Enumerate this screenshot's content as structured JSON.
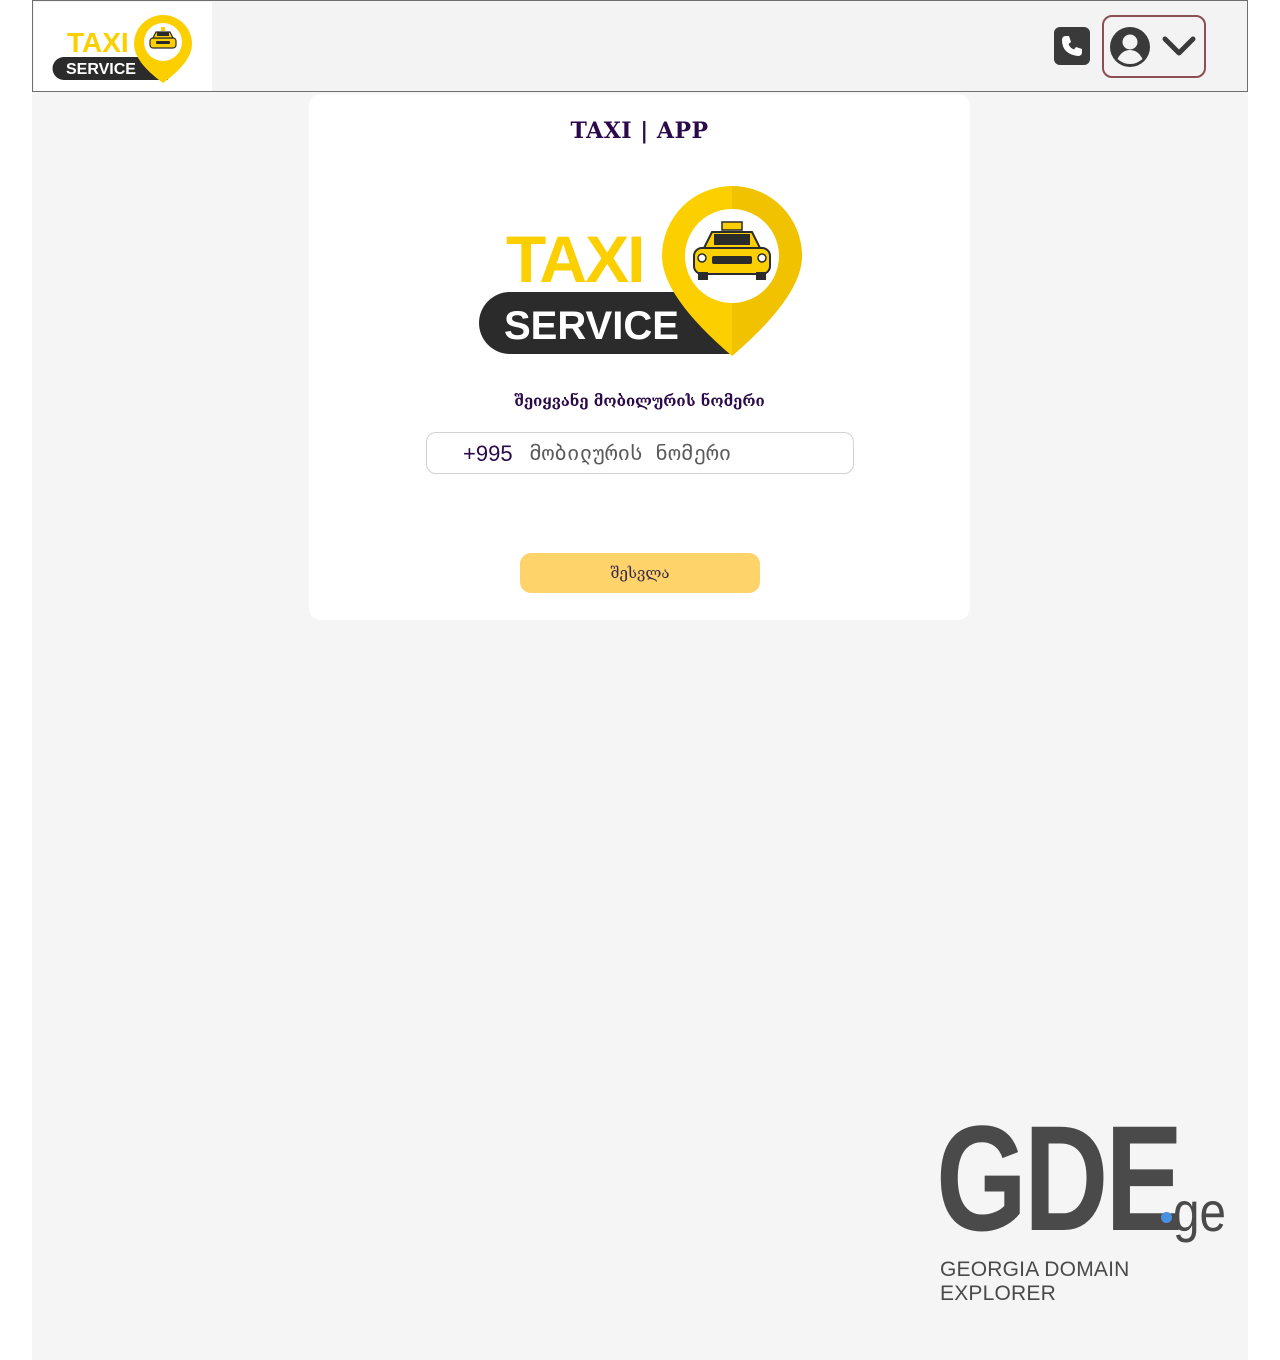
{
  "header": {
    "logo": {
      "text_top": "TAXI",
      "text_bottom": "SERVICE"
    },
    "phone_icon": "phone-icon",
    "user_icon": "user-circle-icon",
    "menu_icon": "chevron-down-icon"
  },
  "login": {
    "title": "TAXI | APP",
    "logo": {
      "text_top": "TAXI",
      "text_bottom": "SERVICE"
    },
    "phone_label": "შეიყვანე მობილურის ნომერი",
    "country_code": "+995",
    "phone_placeholder": "მობილურის ნომერი",
    "phone_value": "",
    "submit_label": "შესვლა"
  },
  "watermark": {
    "title": "GDE",
    "tld": "ge",
    "subtitle": "GEORGIA DOMAIN EXPLORER"
  },
  "colors": {
    "brand_yellow": "#fcd000",
    "button_yellow": "#fed36a",
    "dark_text": "#2a0a4a",
    "logo_dark": "#2b2b2b",
    "user_menu_border": "#8a4f55",
    "watermark_gray": "#4a4a4a",
    "watermark_dot": "#4a90e2"
  }
}
